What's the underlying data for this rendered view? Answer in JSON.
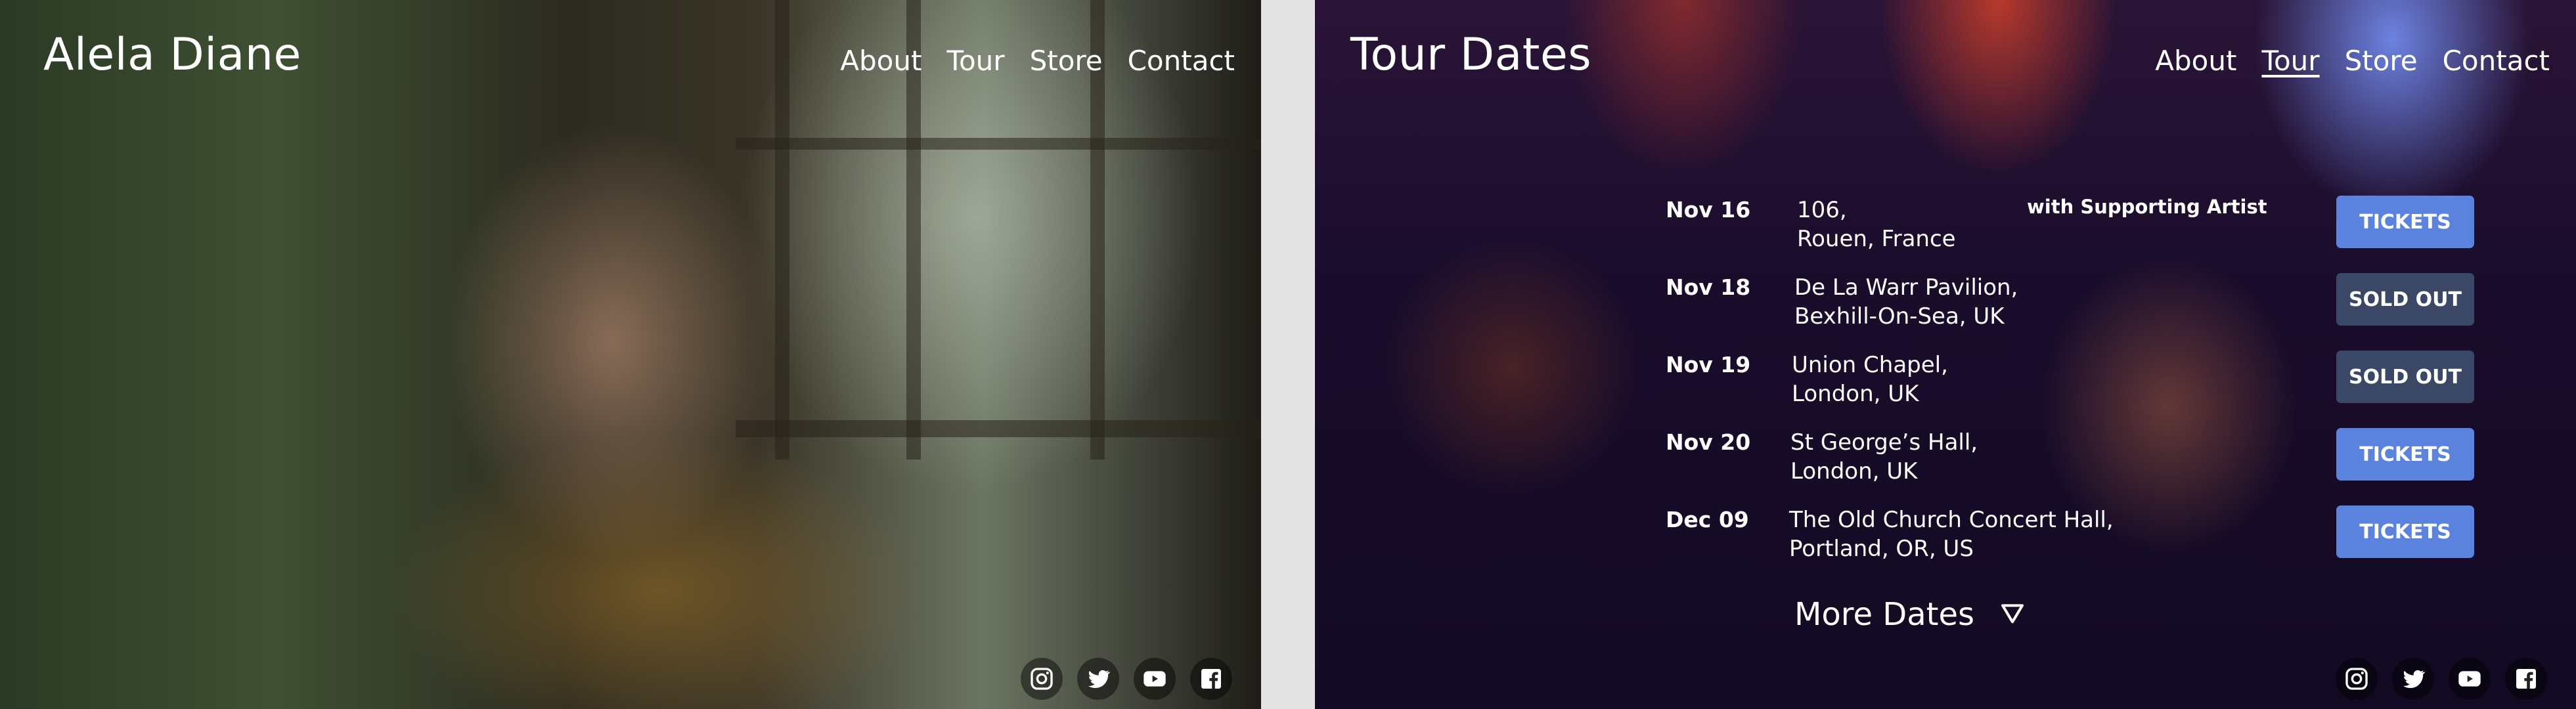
{
  "home": {
    "brand": "Alela Diane",
    "nav": [
      "About",
      "Tour",
      "Store",
      "Contact"
    ],
    "social": [
      "instagram-icon",
      "twitter-icon",
      "youtube-icon",
      "facebook-icon"
    ]
  },
  "tour": {
    "title": "Tour Dates",
    "nav": [
      "About",
      "Tour",
      "Store",
      "Contact"
    ],
    "active_nav": "Tour",
    "rows": [
      {
        "date": "Nov 16",
        "venue": "106,",
        "city": "Rouen, France",
        "support": "with Supporting Artist",
        "button": "TICKETS",
        "status": "tickets"
      },
      {
        "date": "Nov 18",
        "venue": "De La Warr Pavilion,",
        "city": "Bexhill-On-Sea, UK",
        "support": "",
        "button": "SOLD OUT",
        "status": "soldout"
      },
      {
        "date": "Nov 19",
        "venue": "Union Chapel,",
        "city": "London, UK",
        "support": "",
        "button": "SOLD OUT",
        "status": "soldout"
      },
      {
        "date": "Nov 20",
        "venue": "St George’s Hall,",
        "city": "London, UK",
        "support": "",
        "button": "TICKETS",
        "status": "tickets"
      },
      {
        "date": "Dec 09",
        "venue": "The Old Church Concert Hall,",
        "city": "Portland, OR, US",
        "support": "",
        "button": "TICKETS",
        "status": "tickets"
      }
    ],
    "more_dates": "More Dates",
    "social": [
      "instagram-icon",
      "twitter-icon",
      "youtube-icon",
      "facebook-icon"
    ]
  },
  "colors": {
    "tickets": "#5b82dd",
    "soldout": "#3a4866",
    "divider": "#e4e4e4"
  }
}
